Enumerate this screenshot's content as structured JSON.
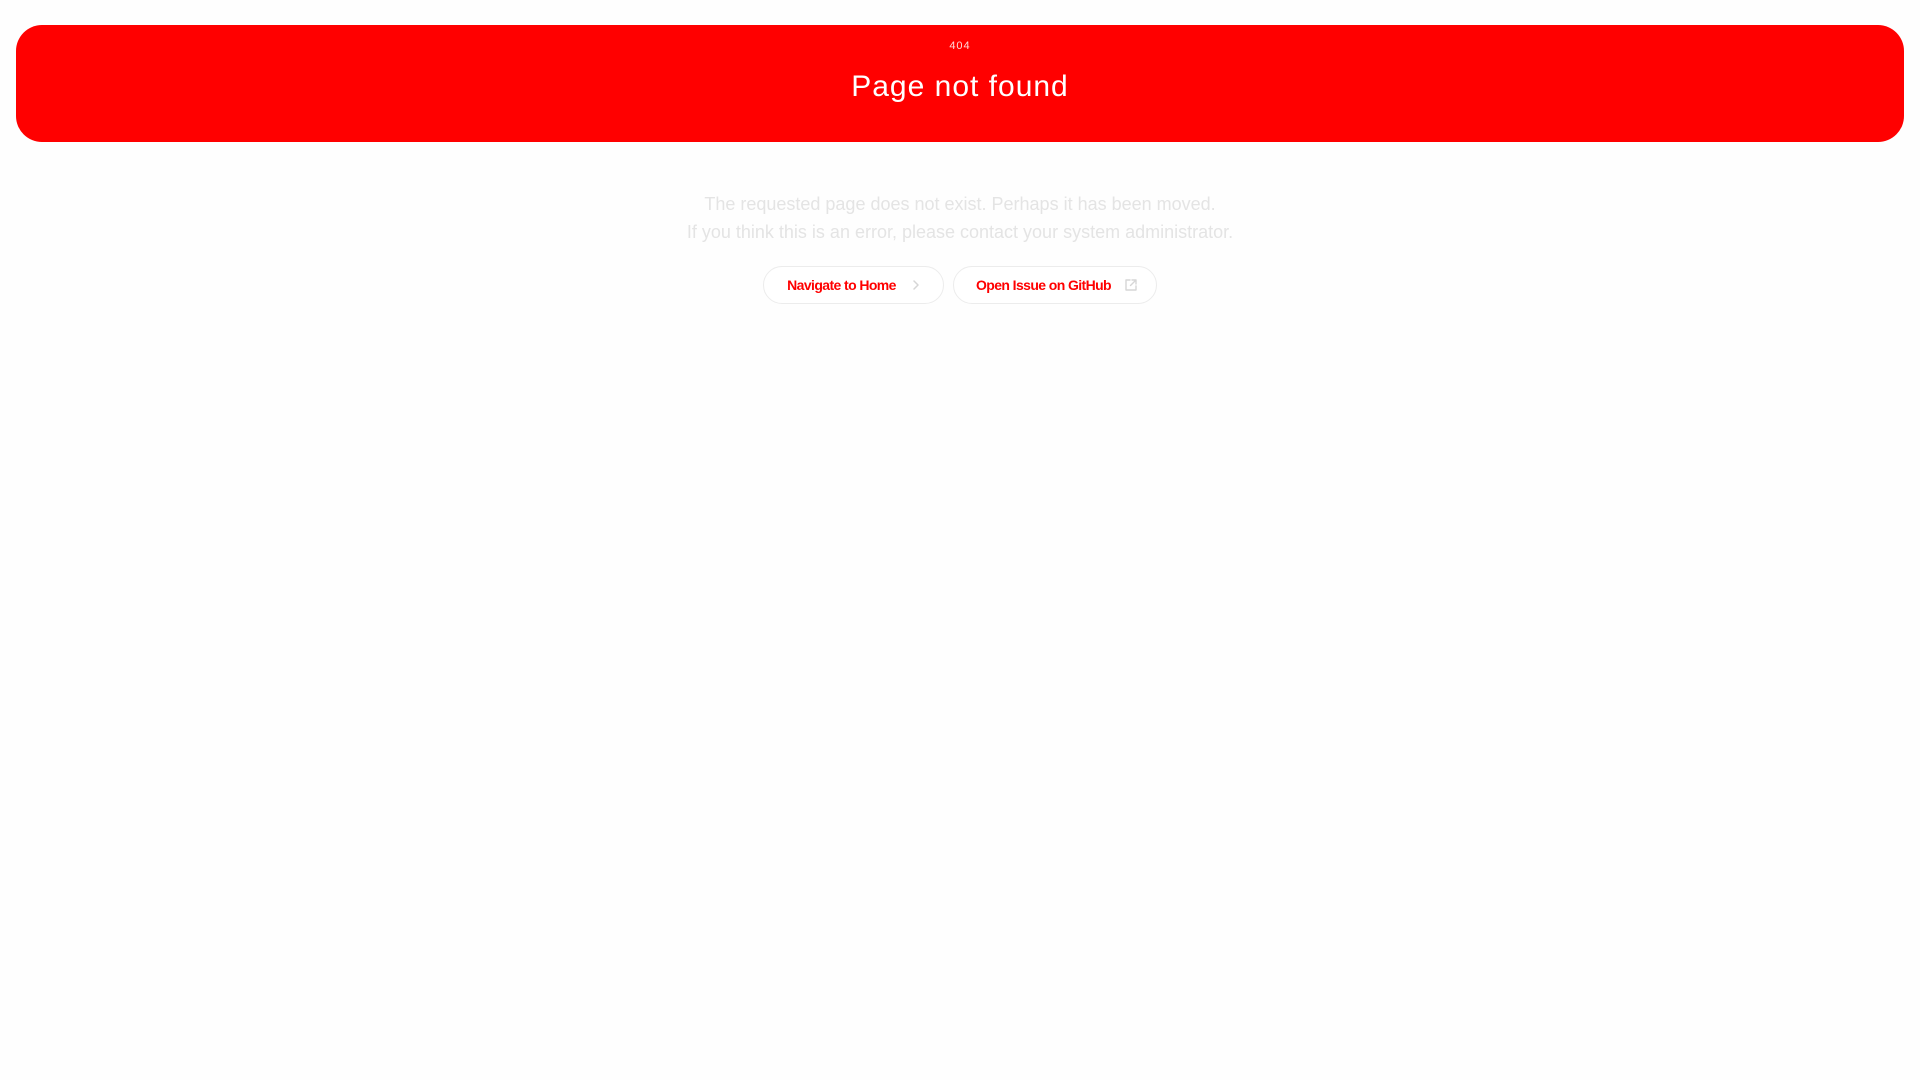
{
  "banner": {
    "code": "404",
    "title": "Page not found"
  },
  "message": {
    "line1": "The requested page does not exist. Perhaps it has been moved.",
    "line2": "If you think this is an error, please contact your system administrator."
  },
  "actions": {
    "home_label": "Navigate to Home",
    "home_icon": "chevron-right-icon",
    "issue_label": "Open Issue on GitHub",
    "issue_icon": "external-link-icon"
  },
  "colors": {
    "accent": "#ff0000",
    "background": "#fefefe",
    "muted_text": "#e4e4e4",
    "button_border": "#ececec"
  }
}
